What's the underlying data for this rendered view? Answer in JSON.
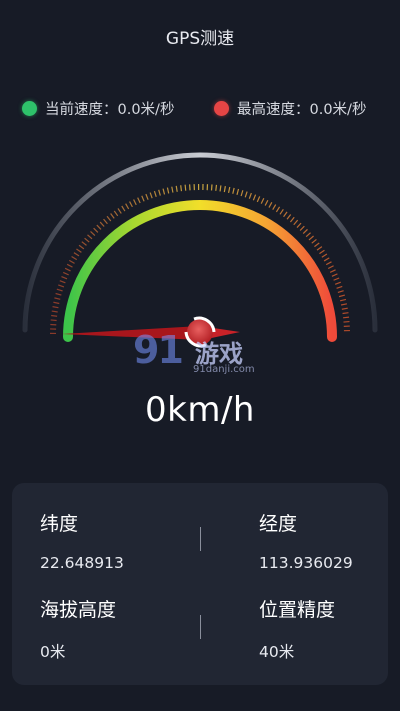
{
  "header": {
    "title": "GPS测速"
  },
  "speed_stats": {
    "current_label": "当前速度：0.0米/秒",
    "max_label": "最高速度：0.0米/秒"
  },
  "gauge": {
    "value": 0,
    "unit": "km/h",
    "readout": "0km/h"
  },
  "watermark": {
    "logo": "91",
    "name": "游戏",
    "url": "91danji.com"
  },
  "info": {
    "latitude": {
      "label": "纬度",
      "value": "22.648913"
    },
    "longitude": {
      "label": "经度",
      "value": "113.936029"
    },
    "altitude": {
      "label": "海拔高度",
      "value": "0米"
    },
    "accuracy": {
      "label": "位置精度",
      "value": "40米"
    }
  },
  "colors": {
    "background": "#171b26",
    "card": "#212633",
    "gauge_green": "#3cc44a",
    "gauge_yellow": "#f2de2a",
    "gauge_red": "#ef4a3a"
  }
}
